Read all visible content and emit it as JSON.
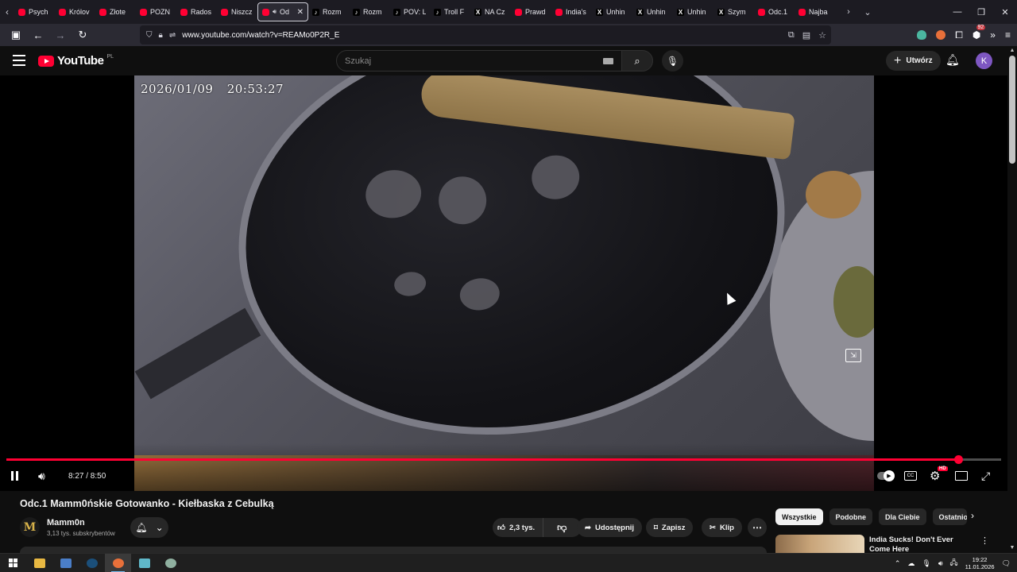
{
  "browser": {
    "tabs": [
      {
        "label": "Psych",
        "favicon": "youtube-icon"
      },
      {
        "label": "Królov",
        "favicon": "youtube-icon"
      },
      {
        "label": "Złote",
        "favicon": "youtube-icon"
      },
      {
        "label": "POZN",
        "favicon": "youtube-icon"
      },
      {
        "label": "Rados",
        "favicon": "youtube-icon"
      },
      {
        "label": "Niszcz",
        "favicon": "youtube-icon"
      },
      {
        "label": "Od",
        "favicon": "youtube-icon",
        "active": true
      },
      {
        "label": "Rozm",
        "favicon": "tiktok-icon"
      },
      {
        "label": "Rozm",
        "favicon": "tiktok-icon"
      },
      {
        "label": "POV: L",
        "favicon": "tiktok-icon"
      },
      {
        "label": "Troll F",
        "favicon": "tiktok-icon"
      },
      {
        "label": "NA Cz",
        "favicon": "x-icon"
      },
      {
        "label": "Prawd",
        "favicon": "youtube-icon"
      },
      {
        "label": "India's",
        "favicon": "youtube-icon"
      },
      {
        "label": "Unhin",
        "favicon": "x-icon"
      },
      {
        "label": "Unhin",
        "favicon": "x-icon"
      },
      {
        "label": "Unhin",
        "favicon": "x-icon"
      },
      {
        "label": "Szym",
        "favicon": "x-icon"
      },
      {
        "label": "Odc.1",
        "favicon": "youtube-icon"
      },
      {
        "label": "Najba",
        "favicon": "youtube-icon"
      }
    ],
    "url": "www.youtube.com/watch?v=REAMo0P2R_E",
    "extension_badge": "92"
  },
  "masthead": {
    "logo_text": "YouTube",
    "country_code": "PL",
    "search_placeholder": "Szukaj",
    "create_label": "Utwórz",
    "avatar_letter": "K"
  },
  "player": {
    "overlay_timestamp": "2026/01/09 20:53:27",
    "time_display": "8:27 / 8:50",
    "progress": 0.957,
    "settings_badge": "HD",
    "cc_label": "CC"
  },
  "video": {
    "title": "Odc.1 Mamm0ńskie Gotowanko - Kiełbaska z Cebulką",
    "channel_name": "Mamm0n",
    "channel_initial": "M",
    "subscribers": "3,13 tys. subskrybentów",
    "likes": "2,3 tys.",
    "share_label": "Udostępnij",
    "save_label": "Zapisz",
    "clip_label": "Klip"
  },
  "sidebar": {
    "chips": [
      "Wszystkie",
      "Podobne",
      "Dla Ciebie",
      "Ostatnio"
    ],
    "recommendation_title": "India Sucks! Don't Ever Come Here"
  },
  "taskbar": {
    "time": "19:22",
    "date": "11.01.2026"
  },
  "colors": {
    "youtube_red": "#ff0033",
    "background": "#0f0f0f",
    "pill": "#272727"
  }
}
